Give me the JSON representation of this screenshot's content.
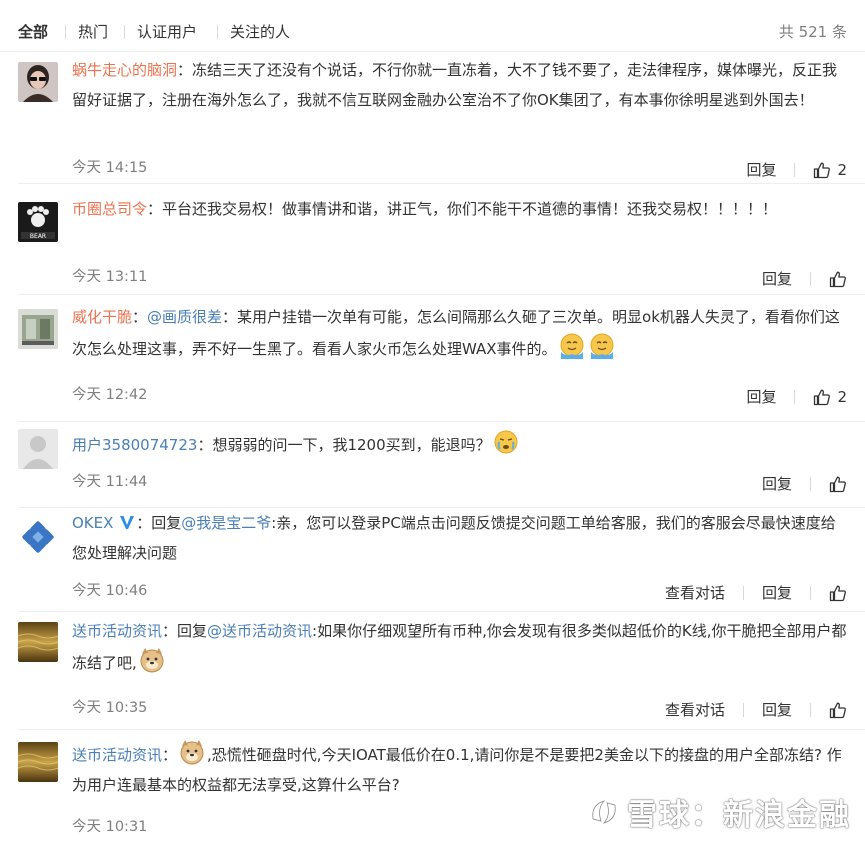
{
  "tabs": {
    "items": [
      "全部",
      "热门",
      "认证用户",
      "关注的人"
    ],
    "total": "共 521 条"
  },
  "actions": {
    "reply": "回复",
    "view_conversation": "查看对话"
  },
  "comments": [
    {
      "user": "蜗牛走心的脑洞",
      "text": "：冻结三天了还没有个说话，不行你就一直冻着，大不了钱不要了，走法律程序，媒体曝光，反正我留好证据了，注册在海外怎么了，我就不信互联网金融办公室治不了你OK集团了，有本事你徐明星逃到外国去！",
      "time": "今天 14:15",
      "likes": "2"
    },
    {
      "user": "币圈总司令",
      "text": "：平台还我交易权！做事情讲和谐，讲正气，你们不能干不道德的事情！还我交易权！！！！！",
      "time": "今天 13:11",
      "likes": ""
    },
    {
      "user": "威化干脆",
      "mention": "@画质很差",
      "text": "：某用户挂错一次单有可能，怎么间隔那么久砸了三次单。明显ok机器人失灵了，看看你们这次怎么处理这事，弄不好一生黑了。看看人家火币怎么处理WAX事件的。",
      "time": "今天 12:42",
      "likes": "2"
    },
    {
      "user": "用户3580074723",
      "text": "：想弱弱的问一下，我1200买到，能退吗？",
      "time": "今天 11:44",
      "likes": ""
    },
    {
      "user": "OKEX",
      "text_pre": "：回复",
      "mention": "@我是宝二爷",
      "text": ":亲，您可以登录PC端点击问题反馈提交问题工单给客服，我们的客服会尽最快速度给您处理解决问题",
      "time": "今天 10:46",
      "likes": ""
    },
    {
      "user": "送币活动资讯",
      "text_pre": "：回复",
      "mention": "@送币活动资讯",
      "text": ":如果你仔细观望所有币种,你会发现有很多类似超低价的K线,你干脆把全部用户都冻结了吧,",
      "time": "今天 10:35",
      "likes": ""
    },
    {
      "user": "送币活动资讯",
      "text_pre": "：",
      "text": ",恐慌性砸盘时代,今天IOAT最低价在0.1,请问你是不是要把2美金以下的接盘的用户全部冻结? 作为用户连最基本的权益都无法享受,这算什么平台?",
      "time": "今天 10:31",
      "likes": ""
    }
  ],
  "watermark": "雪球：新浪金融",
  "colors": {
    "username": "#eb7350",
    "link": "#4a7fb5",
    "meta": "#808080"
  }
}
